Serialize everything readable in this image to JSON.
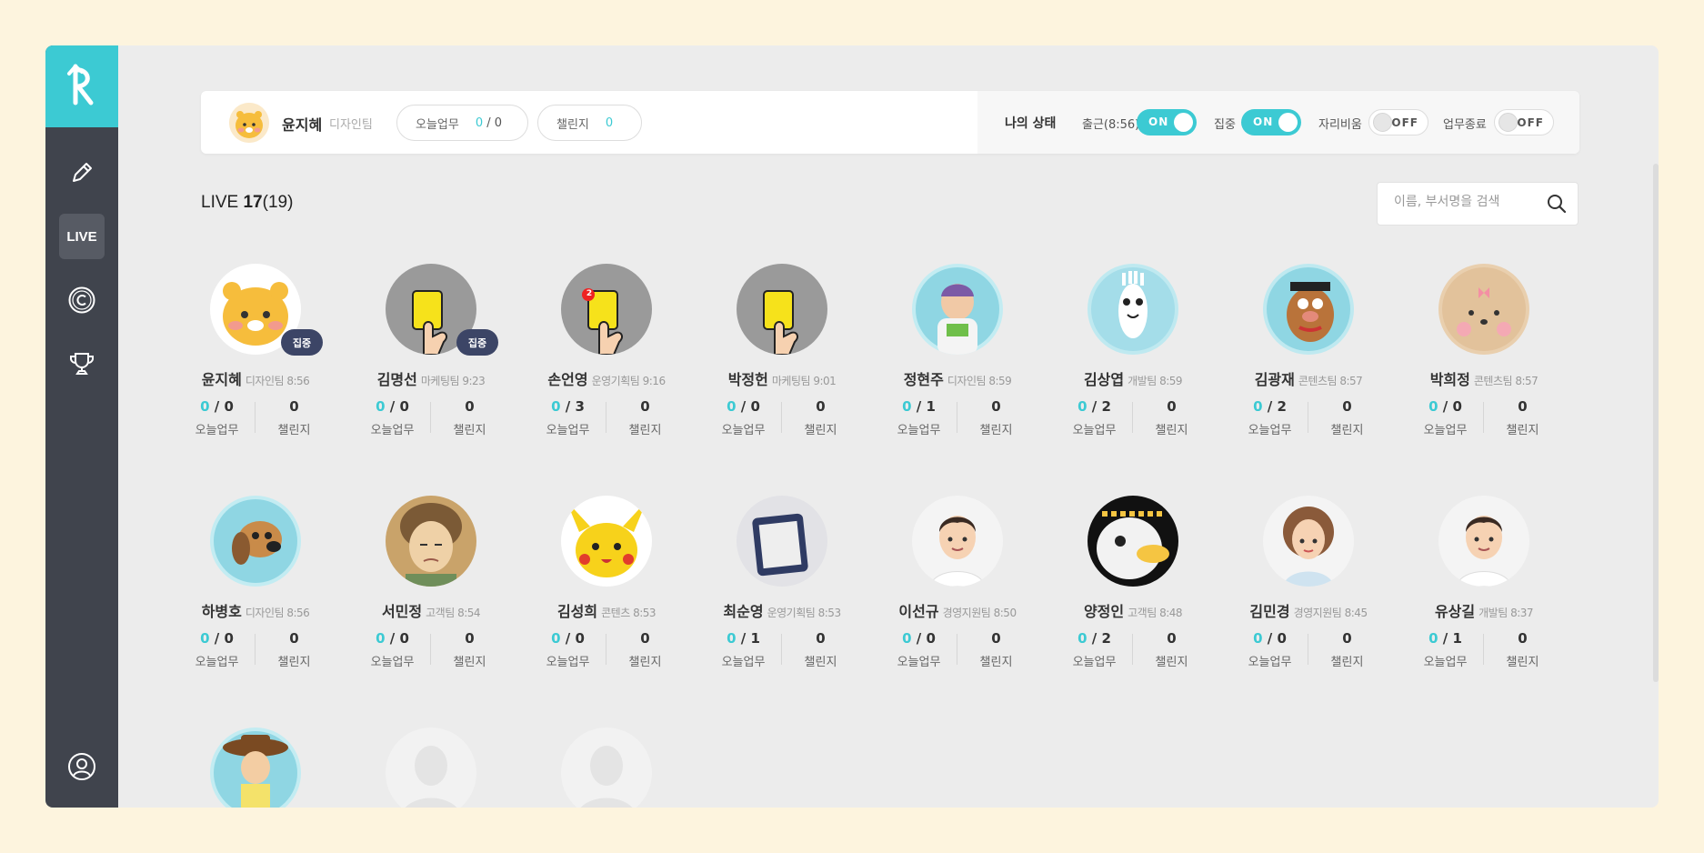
{
  "sidebar": {
    "nav": [
      {
        "name": "edit"
      },
      {
        "name": "live",
        "label": "LIVE"
      },
      {
        "name": "copyright"
      },
      {
        "name": "trophy"
      }
    ]
  },
  "me": {
    "name": "윤지혜",
    "team": "디자인팀",
    "today_tasks_label": "오늘업무",
    "today_done": "0",
    "today_sep": "/",
    "today_total": "0",
    "challenge_label": "챌린지",
    "challenge_value": "0"
  },
  "status": {
    "title": "나의 상태",
    "toggles": [
      {
        "label": "출근(8:56)",
        "state": "ON"
      },
      {
        "label": "집중",
        "state": "ON"
      },
      {
        "label": "자리비움",
        "state": "OFF"
      },
      {
        "label": "업무종료",
        "state": "OFF"
      }
    ]
  },
  "live": {
    "prefix": "LIVE",
    "count": "17",
    "total": "(19)"
  },
  "search": {
    "placeholder": "이름, 부서명을 검색"
  },
  "labels": {
    "tasks": "오늘업무",
    "challenge": "챌린지"
  },
  "colors": {
    "accent": "#3ccad3",
    "sidebar": "#40444d",
    "badge": "#3c4566"
  },
  "members": [
    {
      "name": "윤지혜",
      "team": "디자인팀",
      "time": "8:56",
      "done": "0",
      "total": "0",
      "challenge": "0",
      "badge": "집중",
      "avatar": "yellow-lion-icon"
    },
    {
      "name": "김명선",
      "team": "마케팅팀",
      "time": "9:23",
      "done": "0",
      "total": "0",
      "challenge": "0",
      "badge": "집중",
      "avatar": "yellow-card-icon"
    },
    {
      "name": "손언영",
      "team": "운영기획팀",
      "time": "9:16",
      "done": "0",
      "total": "3",
      "challenge": "0",
      "card_count": "2",
      "avatar": "yellow-card-icon"
    },
    {
      "name": "박정헌",
      "team": "마케팅팀",
      "time": "9:01",
      "done": "0",
      "total": "0",
      "challenge": "0",
      "avatar": "yellow-card-icon"
    },
    {
      "name": "정현주",
      "team": "디자인팀",
      "time": "8:59",
      "done": "0",
      "total": "1",
      "challenge": "0",
      "avatar": "space-ranger-icon"
    },
    {
      "name": "김상엽",
      "team": "개발팀",
      "time": "8:59",
      "done": "0",
      "total": "2",
      "challenge": "0",
      "avatar": "fork-toy-icon"
    },
    {
      "name": "김광재",
      "team": "콘텐츠팀",
      "time": "8:57",
      "done": "0",
      "total": "2",
      "challenge": "0",
      "avatar": "potato-toy-icon"
    },
    {
      "name": "박희정",
      "team": "콘텐츠팀",
      "time": "8:57",
      "done": "0",
      "total": "0",
      "challenge": "0",
      "avatar": "plush-bear-icon"
    },
    {
      "name": "하병호",
      "team": "디자인팀",
      "time": "8:56",
      "done": "0",
      "total": "0",
      "challenge": "0",
      "avatar": "toy-dog-icon"
    },
    {
      "name": "서민정",
      "team": "고객팀",
      "time": "8:54",
      "done": "0",
      "total": "0",
      "challenge": "0",
      "avatar": "grandma-icon"
    },
    {
      "name": "김성희",
      "team": "콘텐츠",
      "time": "8:53",
      "done": "0",
      "total": "0",
      "challenge": "0",
      "avatar": "pikachu-icon"
    },
    {
      "name": "최순영",
      "team": "운영기획팀",
      "time": "8:53",
      "done": "0",
      "total": "1",
      "challenge": "0",
      "avatar": "tablet-photo-icon"
    },
    {
      "name": "이선규",
      "team": "경영지원팀",
      "time": "8:50",
      "done": "0",
      "total": "0",
      "challenge": "0",
      "avatar": "man-illustration-icon"
    },
    {
      "name": "양정인",
      "team": "고객팀",
      "time": "8:48",
      "done": "0",
      "total": "2",
      "challenge": "0",
      "avatar": "duck-doll-icon"
    },
    {
      "name": "김민경",
      "team": "경영지원팀",
      "time": "8:45",
      "done": "0",
      "total": "0",
      "challenge": "0",
      "avatar": "woman-illustration-icon"
    },
    {
      "name": "유상길",
      "team": "개발팀",
      "time": "8:37",
      "done": "0",
      "total": "1",
      "challenge": "0",
      "avatar": "man-illustration-icon"
    }
  ],
  "partial_members": [
    {
      "avatar": "cowboy-toy-icon"
    },
    {
      "avatar": "placeholder-person-icon"
    },
    {
      "avatar": "placeholder-person-icon"
    }
  ]
}
